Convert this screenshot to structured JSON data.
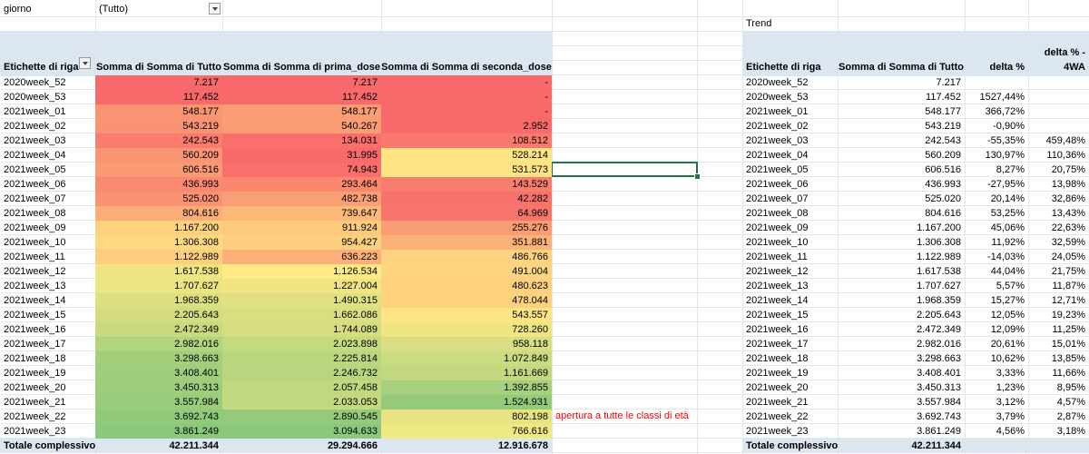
{
  "filter": {
    "label": "giorno",
    "value": "(Tutto)"
  },
  "trend_label": "Trend",
  "left_table": {
    "headers": [
      "Etichette di riga",
      "Somma di Somma di Tutto",
      "Somma di Somma di prima_dose",
      "Somma di Somma di seconda_dose"
    ],
    "rows": [
      {
        "week": "2020week_52",
        "tutto": "7.217",
        "prima": "7.217",
        "seconda": "-"
      },
      {
        "week": "2020week_53",
        "tutto": "117.452",
        "prima": "117.452",
        "seconda": "-"
      },
      {
        "week": "2021week_01",
        "tutto": "548.177",
        "prima": "548.177",
        "seconda": "-"
      },
      {
        "week": "2021week_02",
        "tutto": "543.219",
        "prima": "540.267",
        "seconda": "2.952"
      },
      {
        "week": "2021week_03",
        "tutto": "242.543",
        "prima": "134.031",
        "seconda": "108.512"
      },
      {
        "week": "2021week_04",
        "tutto": "560.209",
        "prima": "31.995",
        "seconda": "528.214"
      },
      {
        "week": "2021week_05",
        "tutto": "606.516",
        "prima": "74.943",
        "seconda": "531.573"
      },
      {
        "week": "2021week_06",
        "tutto": "436.993",
        "prima": "293.464",
        "seconda": "143.529"
      },
      {
        "week": "2021week_07",
        "tutto": "525.020",
        "prima": "482.738",
        "seconda": "42.282"
      },
      {
        "week": "2021week_08",
        "tutto": "804.616",
        "prima": "739.647",
        "seconda": "64.969"
      },
      {
        "week": "2021week_09",
        "tutto": "1.167.200",
        "prima": "911.924",
        "seconda": "255.276"
      },
      {
        "week": "2021week_10",
        "tutto": "1.306.308",
        "prima": "954.427",
        "seconda": "351.881"
      },
      {
        "week": "2021week_11",
        "tutto": "1.122.989",
        "prima": "636.223",
        "seconda": "486.766"
      },
      {
        "week": "2021week_12",
        "tutto": "1.617.538",
        "prima": "1.126.534",
        "seconda": "491.004"
      },
      {
        "week": "2021week_13",
        "tutto": "1.707.627",
        "prima": "1.227.004",
        "seconda": "480.623"
      },
      {
        "week": "2021week_14",
        "tutto": "1.968.359",
        "prima": "1.490.315",
        "seconda": "478.044"
      },
      {
        "week": "2021week_15",
        "tutto": "2.205.643",
        "prima": "1.662.086",
        "seconda": "543.557"
      },
      {
        "week": "2021week_16",
        "tutto": "2.472.349",
        "prima": "1.744.089",
        "seconda": "728.260"
      },
      {
        "week": "2021week_17",
        "tutto": "2.982.016",
        "prima": "2.023.898",
        "seconda": "958.118"
      },
      {
        "week": "2021week_18",
        "tutto": "3.298.663",
        "prima": "2.225.814",
        "seconda": "1.072.849"
      },
      {
        "week": "2021week_19",
        "tutto": "3.408.401",
        "prima": "2.246.732",
        "seconda": "1.161.669"
      },
      {
        "week": "2021week_20",
        "tutto": "3.450.313",
        "prima": "2.057.458",
        "seconda": "1.392.855"
      },
      {
        "week": "2021week_21",
        "tutto": "3.557.984",
        "prima": "2.033.053",
        "seconda": "1.524.931"
      },
      {
        "week": "2021week_22",
        "tutto": "3.692.743",
        "prima": "2.890.545",
        "seconda": "802.198"
      },
      {
        "week": "2021week_23",
        "tutto": "3.861.249",
        "prima": "3.094.633",
        "seconda": "766.616"
      }
    ],
    "total": {
      "label": "Totale complessivo",
      "tutto": "42.211.344",
      "prima": "29.294.666",
      "seconda": "12.916.678"
    },
    "colors": {
      "tutto": [
        "#f8696b",
        "#f8696b",
        "#fa9473",
        "#fa9373",
        "#f97c6e",
        "#fa9574",
        "#fa9a75",
        "#f98a71",
        "#fa9373",
        "#fbad78",
        "#fed17f",
        "#fed981",
        "#fece7e",
        "#efe583",
        "#eae483",
        "#dde081",
        "#d3dd80",
        "#c8da7f",
        "#b2d47e",
        "#a3cf7d",
        "#a0ce7d",
        "#9ecd7c",
        "#99cc7c",
        "#92ca7b",
        "#8ac87b"
      ],
      "prima": [
        "#f8696b",
        "#f8696b",
        "#fa9d75",
        "#fa9c75",
        "#f86f6c",
        "#f8696b",
        "#f86f6c",
        "#f9886f",
        "#fa9e75",
        "#fcb97a",
        "#fdcb7e",
        "#fdcf7f",
        "#fcaf79",
        "#ffea84",
        "#f1e583",
        "#e2e182",
        "#d9df81",
        "#d5dd80",
        "#c5d97f",
        "#bad67e",
        "#b9d57e",
        "#c1d87f",
        "#c2d97f",
        "#95ca7b",
        "#8ac87b"
      ],
      "seconda": [
        "#f8696b",
        "#f8696b",
        "#f8696b",
        "#f86a6b",
        "#f8796e",
        "#fee482",
        "#fee482",
        "#f97d6e",
        "#f8726c",
        "#f8756d",
        "#fa9d74",
        "#fbb278",
        "#fed380",
        "#fed480",
        "#fed17f",
        "#fed17f",
        "#fee482",
        "#f0e583",
        "#d8de81",
        "#cbdb80",
        "#c1d87f",
        "#a6d07d",
        "#95ca7b",
        "#e8e382",
        "#edea83"
      ]
    }
  },
  "annotation": "apertura a tutte le classi di età",
  "right_table": {
    "headers": [
      "Etichette di riga",
      "Somma di Somma di Tutto",
      "delta %",
      "delta % -",
      "4WA"
    ],
    "rows": [
      {
        "week": "2020week_52",
        "tutto": "7.217",
        "delta": "",
        "wa": ""
      },
      {
        "week": "2020week_53",
        "tutto": "117.452",
        "delta": "1527,44%",
        "wa": ""
      },
      {
        "week": "2021week_01",
        "tutto": "548.177",
        "delta": "366,72%",
        "wa": ""
      },
      {
        "week": "2021week_02",
        "tutto": "543.219",
        "delta": "-0,90%",
        "wa": ""
      },
      {
        "week": "2021week_03",
        "tutto": "242.543",
        "delta": "-55,35%",
        "wa": "459,48%"
      },
      {
        "week": "2021week_04",
        "tutto": "560.209",
        "delta": "130,97%",
        "wa": "110,36%"
      },
      {
        "week": "2021week_05",
        "tutto": "606.516",
        "delta": "8,27%",
        "wa": "20,75%"
      },
      {
        "week": "2021week_06",
        "tutto": "436.993",
        "delta": "-27,95%",
        "wa": "13,98%"
      },
      {
        "week": "2021week_07",
        "tutto": "525.020",
        "delta": "20,14%",
        "wa": "32,86%"
      },
      {
        "week": "2021week_08",
        "tutto": "804.616",
        "delta": "53,25%",
        "wa": "13,43%"
      },
      {
        "week": "2021week_09",
        "tutto": "1.167.200",
        "delta": "45,06%",
        "wa": "22,63%"
      },
      {
        "week": "2021week_10",
        "tutto": "1.306.308",
        "delta": "11,92%",
        "wa": "32,59%"
      },
      {
        "week": "2021week_11",
        "tutto": "1.122.989",
        "delta": "-14,03%",
        "wa": "24,05%"
      },
      {
        "week": "2021week_12",
        "tutto": "1.617.538",
        "delta": "44,04%",
        "wa": "21,75%"
      },
      {
        "week": "2021week_13",
        "tutto": "1.707.627",
        "delta": "5,57%",
        "wa": "11,87%"
      },
      {
        "week": "2021week_14",
        "tutto": "1.968.359",
        "delta": "15,27%",
        "wa": "12,71%"
      },
      {
        "week": "2021week_15",
        "tutto": "2.205.643",
        "delta": "12,05%",
        "wa": "19,23%"
      },
      {
        "week": "2021week_16",
        "tutto": "2.472.349",
        "delta": "12,09%",
        "wa": "11,25%"
      },
      {
        "week": "2021week_17",
        "tutto": "2.982.016",
        "delta": "20,61%",
        "wa": "15,01%"
      },
      {
        "week": "2021week_18",
        "tutto": "3.298.663",
        "delta": "10,62%",
        "wa": "13,85%"
      },
      {
        "week": "2021week_19",
        "tutto": "3.408.401",
        "delta": "3,33%",
        "wa": "11,66%"
      },
      {
        "week": "2021week_20",
        "tutto": "3.450.313",
        "delta": "1,23%",
        "wa": "8,95%"
      },
      {
        "week": "2021week_21",
        "tutto": "3.557.984",
        "delta": "3,12%",
        "wa": "4,57%"
      },
      {
        "week": "2021week_22",
        "tutto": "3.692.743",
        "delta": "3,79%",
        "wa": "2,87%"
      },
      {
        "week": "2021week_23",
        "tutto": "3.861.249",
        "delta": "4,56%",
        "wa": "3,18%"
      }
    ],
    "total": {
      "label": "Totale complessivo",
      "tutto": "42.211.344"
    }
  },
  "colors": {
    "header_bg": "#dce6f1",
    "selection": "#217346",
    "annotation": "#ff0000"
  }
}
